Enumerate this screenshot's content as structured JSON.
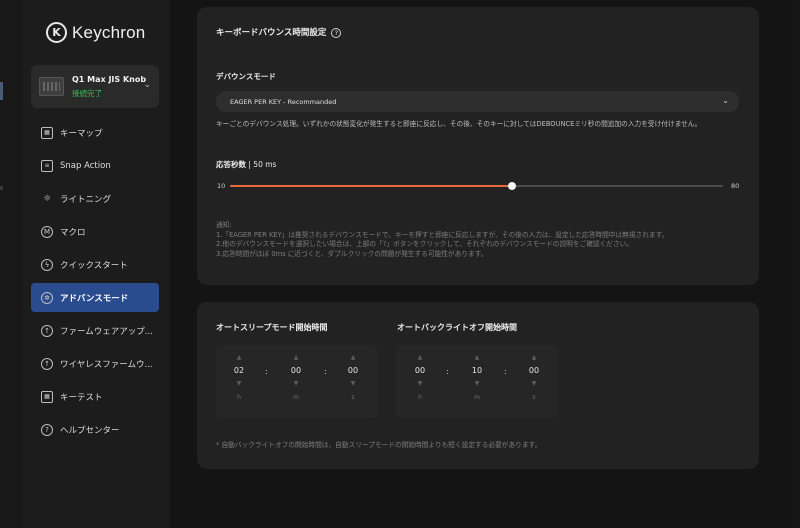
{
  "app": {
    "logo_text": "Keychron"
  },
  "device": {
    "name": "Q1 Max JIS Knob",
    "status": "接続完了"
  },
  "sidebar": {
    "items": [
      {
        "label": "キーマップ",
        "icon": "keyboard-icon"
      },
      {
        "label": "Snap Action",
        "icon": "snap-icon"
      },
      {
        "label": "ライトニング",
        "icon": "sun-icon"
      },
      {
        "label": "マクロ",
        "icon": "macro-icon"
      },
      {
        "label": "クイックスタート",
        "icon": "bolt-icon"
      },
      {
        "label": "アドバンスモード",
        "icon": "gear-icon",
        "active": true
      },
      {
        "label": "ファームウェアアップ...",
        "icon": "upload-icon"
      },
      {
        "label": "ワイヤレスファームウ...",
        "icon": "upload-icon"
      },
      {
        "label": "キーテスト",
        "icon": "keyboard-icon"
      },
      {
        "label": "ヘルプセンター",
        "icon": "question-icon"
      }
    ]
  },
  "debounce": {
    "title": "キーボードバウンス時間設定",
    "mode_label": "デバウンスモード",
    "mode_value": "EAGER PER KEY - Recommanded",
    "description": "キーごとのデバウンス処理。いずれかの状態変化が発生すると即座に反応し、その後、そのキーに対してはDEBOUNCEミリ秒の間追加の入力を受け付けません。",
    "response_label": "応答秒数",
    "response_value": "50 ms",
    "slider_min": "10",
    "slider_max": "80",
    "slider_value": 50,
    "notes": [
      "通知:",
      "1.「EAGER PER KEY」は推奨されるデバウンスモードで、キーを押すと即座に反応しますが、その後の入力は、設定した応答時間中は無視されます。",
      "2.他のデバウンスモードを選択したい場合は、上部の「?」ボタンをクリックして、それぞれのデバウンスモードの説明をご確認ください。",
      "3.応答時間がほぼ 0ms に近づくと、ダブルクリックの問題が発生する可能性があります。"
    ]
  },
  "sleep": {
    "auto_sleep_title": "オートスリープモード開始時間",
    "backlight_off_title": "オートバックライトオフ開始時間",
    "auto_sleep": {
      "h": "02",
      "m": "00",
      "s": "00"
    },
    "backlight_off": {
      "h": "00",
      "m": "10",
      "s": "00"
    },
    "units": {
      "h": "h",
      "m": "m",
      "s": "s"
    },
    "footnote": "* 自動バックライトオフの開始時間は、自動スリープモードの開始時間よりも短く設定する必要があります。"
  },
  "colors": {
    "accent": "#e8673d",
    "active_nav": "#2b4b8f",
    "status_green": "#3bbf5a"
  }
}
